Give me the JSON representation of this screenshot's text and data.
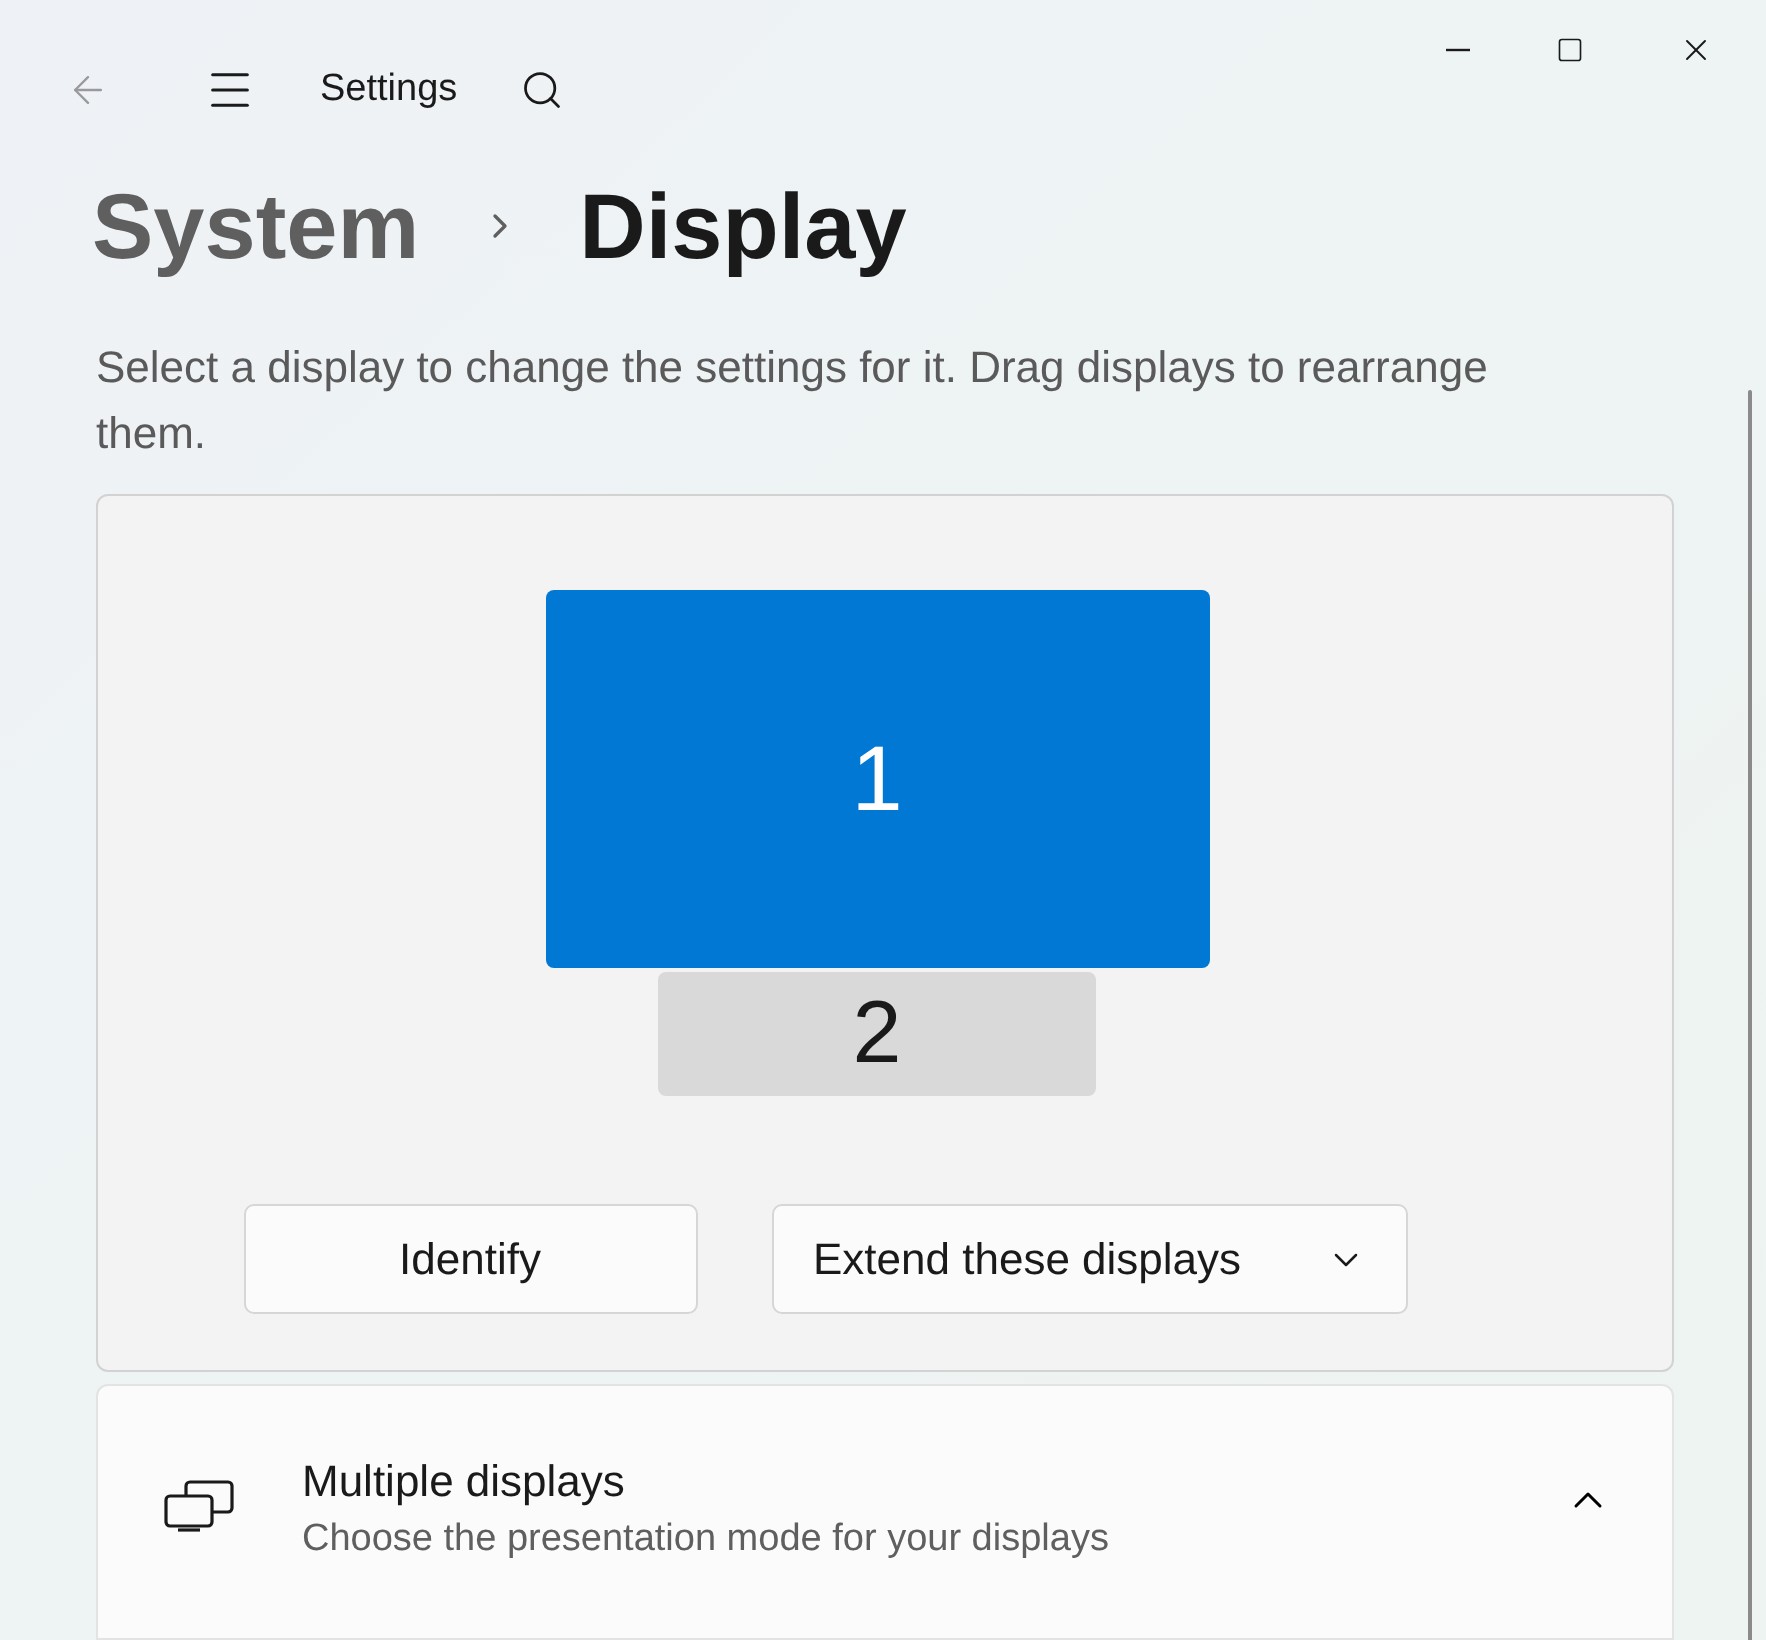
{
  "window": {
    "title": "Settings"
  },
  "breadcrumb": [
    {
      "label": "System",
      "current": false
    },
    {
      "label": "Display",
      "current": true
    }
  ],
  "description": "Select a display to change the settings for it. Drag displays to rearrange them.",
  "displays": [
    {
      "label": "1",
      "selected": true
    },
    {
      "label": "2",
      "selected": false
    }
  ],
  "identify_button": "Identify",
  "mode_dropdown": {
    "value": "Extend these displays"
  },
  "section": {
    "title": "Multiple displays",
    "subtitle": "Choose the presentation mode for your displays",
    "expanded": true
  }
}
